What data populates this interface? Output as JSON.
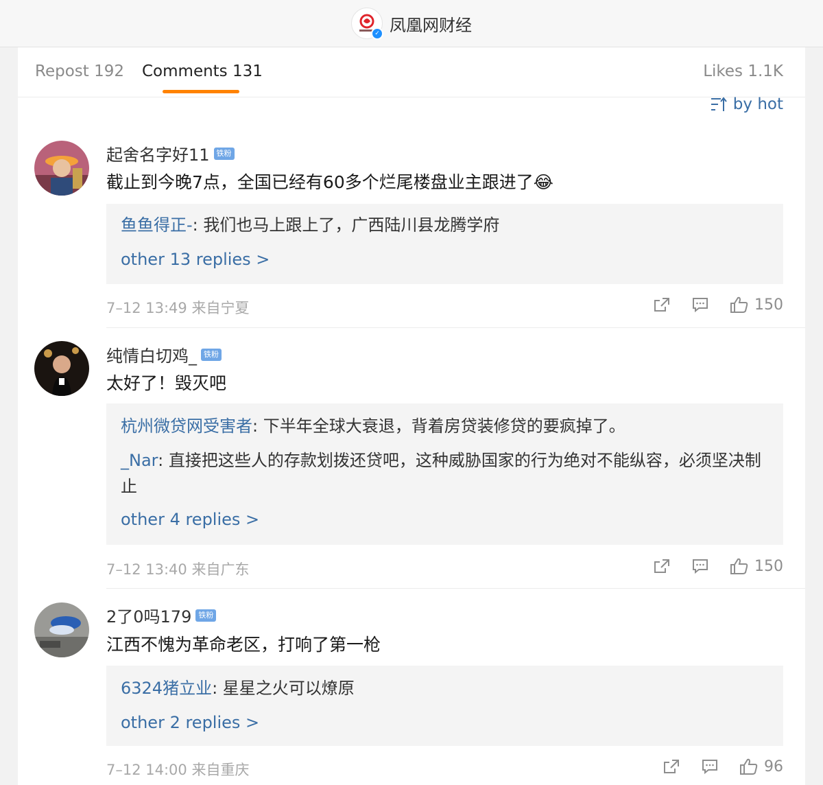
{
  "header": {
    "account_name": "凤凰网财经",
    "logo_text": "凤凰网财经"
  },
  "tabs": {
    "repost": "Repost 192",
    "comments": "Comments 131",
    "likes": "Likes 1.1K"
  },
  "sort": {
    "label": "by hot"
  },
  "comments": [
    {
      "user": "起舍名字好11",
      "badge": "铁粉",
      "text": "截止到今晚7点，全国已经有60多个烂尾楼盘业主跟进了",
      "emoji": "😂",
      "replies": [
        {
          "user": "鱼鱼得正-",
          "sep": ": ",
          "text": "我们也马上跟上了，广西陆川县龙腾学府"
        }
      ],
      "more": "other 13 replies >",
      "time": "7–12 13:49",
      "location": "来自宁夏",
      "likes": "150"
    },
    {
      "user": "纯情白切鸡_",
      "badge": "铁粉",
      "text": "太好了！毁灭吧",
      "replies": [
        {
          "user": "杭州微贷网受害者",
          "sep": ": ",
          "text": "下半年全球大衰退，背着房贷装修贷的要疯掉了。"
        },
        {
          "user": "_Nar",
          "sep": ": ",
          "text": "直接把这些人的存款划拨还贷吧，这种威胁国家的行为绝对不能纵容，必须坚决制止"
        }
      ],
      "more": "other 4 replies >",
      "time": "7–12 13:40",
      "location": "来自广东",
      "likes": "150"
    },
    {
      "user": "2了0吗179",
      "badge": "铁粉",
      "text": "江西不愧为革命老区，打响了第一枪",
      "replies": [
        {
          "user": "6324猪立业",
          "sep": ": ",
          "text": "星星之火可以燎原"
        }
      ],
      "more": "other 2 replies >",
      "time": "7–12 14:00",
      "location": "来自重庆",
      "likes": "96"
    }
  ]
}
